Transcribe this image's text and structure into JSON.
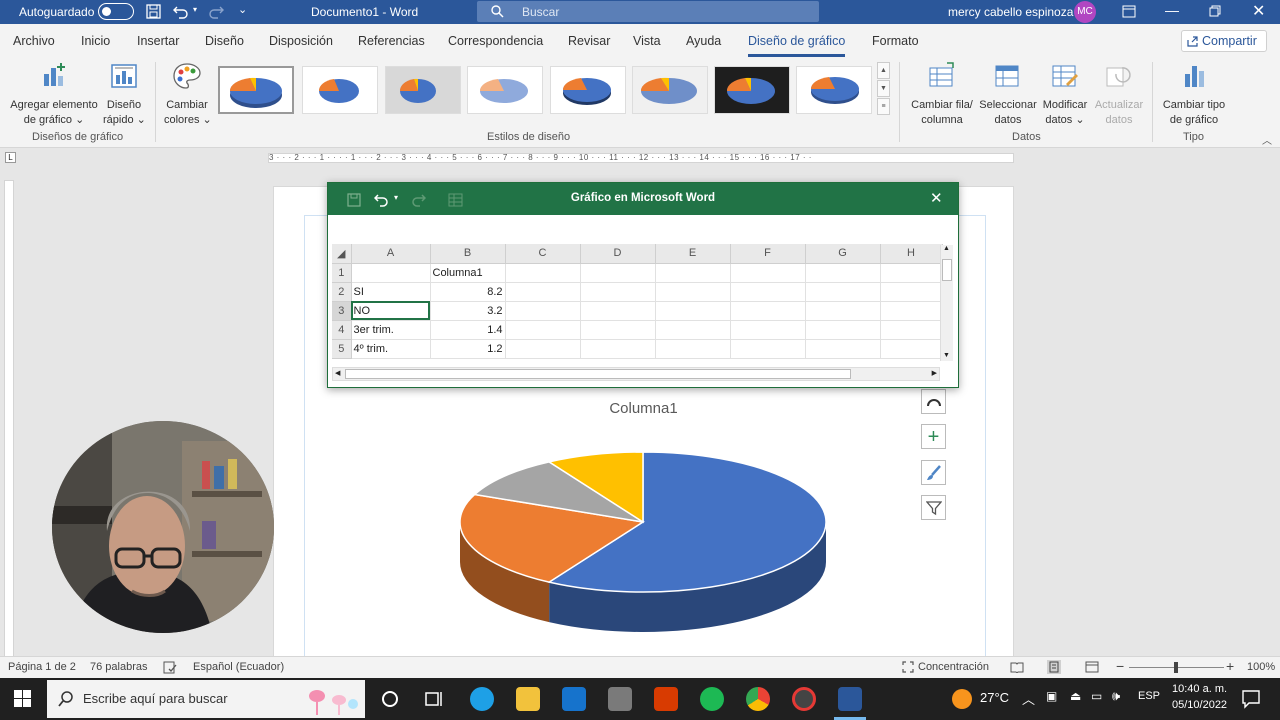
{
  "titlebar": {
    "autosave_label": "Autoguardado",
    "document_title": "Documento1 - Word",
    "search_placeholder": "Buscar",
    "user_name": "mercy cabello espinoza",
    "user_initials": "MC"
  },
  "tabs": [
    "Archivo",
    "Inicio",
    "Insertar",
    "Diseño",
    "Disposición",
    "Referencias",
    "Correspondencia",
    "Revisar",
    "Vista",
    "Ayuda",
    "Diseño de gráfico",
    "Formato"
  ],
  "active_tab": "Diseño de gráfico",
  "share_label": "Compartir",
  "ribbon": {
    "add_element_label": [
      "Agregar elemento",
      "de gráfico"
    ],
    "quick_layout_label": [
      "Diseño",
      "rápido"
    ],
    "change_colors_label": [
      "Cambiar",
      "colores"
    ],
    "group_designs": "Diseños de gráfico",
    "group_styles": "Estilos de diseño",
    "switch_row_col_label": [
      "Cambiar fila/",
      "columna"
    ],
    "select_data_label": [
      "Seleccionar",
      "datos"
    ],
    "edit_data_label": [
      "Modificar",
      "datos"
    ],
    "refresh_data_label": [
      "Actualizar",
      "datos"
    ],
    "group_data": "Datos",
    "change_type_label": [
      "Cambiar tipo",
      "de gráfico"
    ],
    "group_type": "Tipo"
  },
  "excel": {
    "title": "Gráfico en Microsoft Word",
    "columns": [
      "A",
      "B",
      "C",
      "D",
      "E",
      "F",
      "G",
      "H"
    ],
    "rows": [
      {
        "n": "1",
        "a": "",
        "b": "Columna1"
      },
      {
        "n": "2",
        "a": "SI",
        "b": "8.2"
      },
      {
        "n": "3",
        "a": "NO",
        "b": "3.2"
      },
      {
        "n": "4",
        "a": "3er trim.",
        "b": "1.4"
      },
      {
        "n": "5",
        "a": "4º trim.",
        "b": "1.2"
      }
    ],
    "selected_cell": "A3"
  },
  "chart_data": {
    "type": "pie",
    "title": "Columna1",
    "categories": [
      "SI",
      "NO",
      "3er trim.",
      "4º trim."
    ],
    "values": [
      8.2,
      3.2,
      1.4,
      1.2
    ],
    "colors": [
      "#4472c4",
      "#ed7d31",
      "#a5a5a5",
      "#ffc000"
    ],
    "legend": "none"
  },
  "statusbar": {
    "page": "Página 1 de 2",
    "words": "76 palabras",
    "language": "Español (Ecuador)",
    "focus": "Concentración",
    "zoom": "100%"
  },
  "taskbar": {
    "search_placeholder": "Escribe aquí para buscar",
    "temperature": "27°C",
    "lang": "ESP",
    "time": "10:40 a. m.",
    "date": "05/10/2022"
  }
}
